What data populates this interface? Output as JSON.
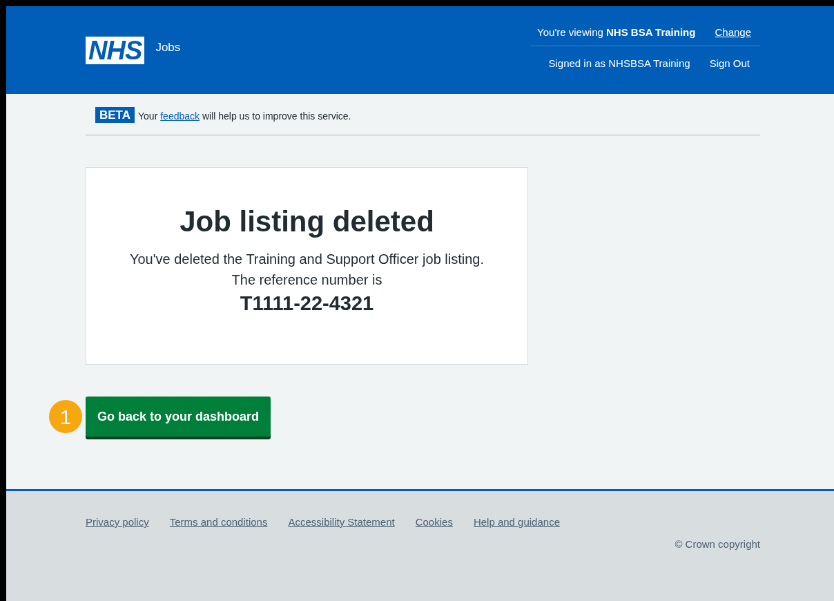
{
  "header": {
    "logo": "NHS",
    "service": "Jobs",
    "viewing": "You're viewing **NHS BSA Training**",
    "change_link": "Change",
    "signed_in": "Signed in as NHSBSA Training",
    "sign_out": "Sign Out"
  },
  "beta_banner": {
    "tag": "BETA",
    "text_before": "Your ",
    "link": "feedback",
    "text_after": " will help us to improve this service."
  },
  "panel": {
    "title": "Job listing deleted",
    "body": "You've deleted the Training and Support Officer job listing.",
    "reference_label": "The reference number is",
    "reference": "T1111-22-4321"
  },
  "step_marker": "1",
  "button": "Go back to your dashboard",
  "footer": {
    "links": [
      "Privacy policy",
      "Terms and conditions",
      "Accessibility Statement",
      "Cookies",
      "Help and guidance"
    ],
    "copyright": "© Crown copyright"
  }
}
